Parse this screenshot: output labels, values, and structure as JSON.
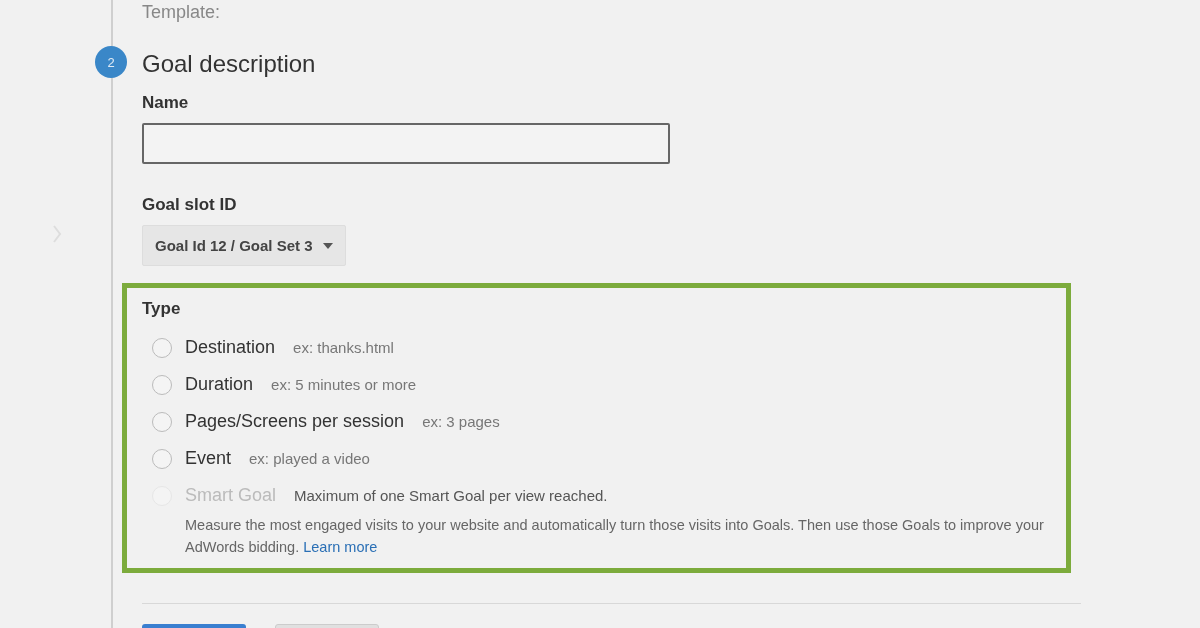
{
  "template_label": "Template:",
  "step": {
    "number": "2",
    "title": "Goal description"
  },
  "name_field": {
    "label": "Name"
  },
  "goal_slot": {
    "label": "Goal slot ID",
    "value": "Goal Id 12 / Goal Set 3"
  },
  "type": {
    "label": "Type",
    "options": [
      {
        "label": "Destination",
        "hint": "ex: thanks.html",
        "selected": false,
        "disabled": false
      },
      {
        "label": "Duration",
        "hint": "ex: 5 minutes or more",
        "selected": false,
        "disabled": false
      },
      {
        "label": "Pages/Screens per session",
        "hint": "ex: 3 pages",
        "selected": false,
        "disabled": false
      },
      {
        "label": "Event",
        "hint": "ex: played a video",
        "selected": false,
        "disabled": false
      },
      {
        "label": "Smart Goal",
        "hint": "Maximum of one Smart Goal per view reached.",
        "selected": false,
        "disabled": true
      }
    ],
    "description": "Measure the most engaged visits to your website and automatically turn those visits into Goals. Then use those Goals to improve your AdWords bidding.",
    "link": "Learn more"
  },
  "buttons": [
    {
      "kind": "primary"
    },
    {
      "kind": "secondary"
    }
  ]
}
